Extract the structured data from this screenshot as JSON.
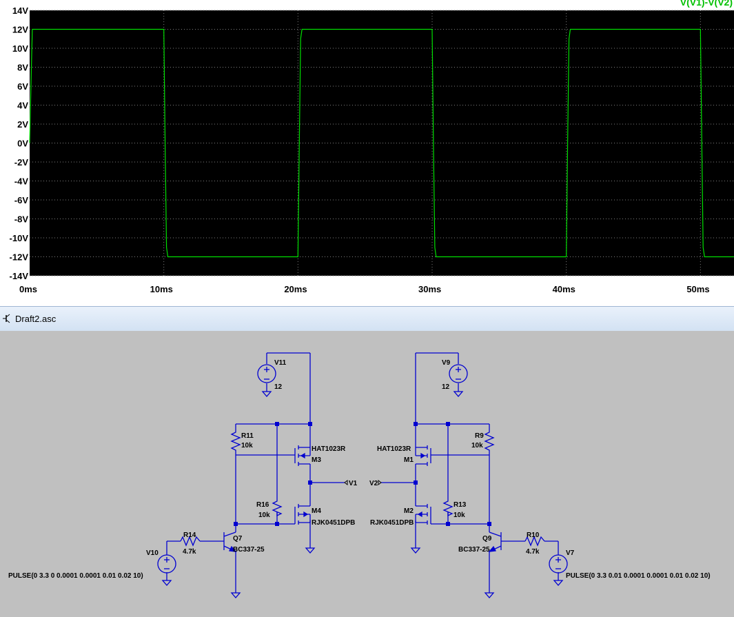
{
  "waveform": {
    "trace_label": "V(V1)-V(V2)",
    "colors": {
      "background": "#000000",
      "trace": "#00e000",
      "grid": "#808080",
      "label": "#00c000"
    },
    "chart_data": {
      "type": "line",
      "title": "",
      "xlabel": "",
      "ylabel": "",
      "xlim": [
        0,
        52.5
      ],
      "ylim": [
        -14,
        14
      ],
      "x_ticks": [
        "0ms",
        "10ms",
        "20ms",
        "30ms",
        "40ms",
        "50ms"
      ],
      "y_ticks": [
        "14V",
        "12V",
        "10V",
        "8V",
        "6V",
        "4V",
        "2V",
        "0V",
        "-2V",
        "-4V",
        "-6V",
        "-8V",
        "-10V",
        "-12V",
        "-14V"
      ],
      "grid": true,
      "series": [
        {
          "name": "V(V1)-V(V2)",
          "x": [
            0,
            0.1,
            0.2,
            10.0,
            10.1,
            10.2,
            10.3,
            20.0,
            20.1,
            20.2,
            20.3,
            30.0,
            30.1,
            30.2,
            30.3,
            40.0,
            40.1,
            40.2,
            40.3,
            50.0,
            50.1,
            50.2,
            50.3,
            52.5
          ],
          "y": [
            0,
            6,
            12,
            12,
            0,
            -11,
            -12,
            -12,
            0,
            11,
            12,
            12,
            0,
            -11,
            -12,
            -12,
            0,
            11,
            12,
            12,
            0,
            -11,
            -12,
            -12
          ]
        }
      ]
    }
  },
  "schematic": {
    "window_title": "Draft2.asc",
    "labels": {
      "v11": "V11",
      "v11_val": "12",
      "v9": "V9",
      "v9_val": "12",
      "r11": "R11",
      "r11_val": "10k",
      "r9": "R9",
      "r9_val": "10k",
      "m3_part": "HAT1023R",
      "m3": "M3",
      "m1_part": "HAT1023R",
      "m1": "M1",
      "net_v1": "V1",
      "net_v2": "V2",
      "r16": "R16",
      "r16_val": "10k",
      "r13": "R13",
      "r13_val": "10k",
      "m4": "M4",
      "m4_part": "RJK0451DPB",
      "m2": "M2",
      "m2_part": "RJK0451DPB",
      "r14": "R14",
      "r14_val": "4.7k",
      "r10": "R10",
      "r10_val": "4.7k",
      "q7": "Q7",
      "q7_part": "BC337-25",
      "q9": "Q9",
      "q9_part": "BC337-25",
      "v10": "V10",
      "v7": "V7",
      "v10_val": "PULSE(0 3.3 0 0.0001 0.0001 0.01 0.02 10)",
      "v7_val": "PULSE(0 3.3 0.01 0.0001 0.0001 0.01 0.02 10)"
    }
  }
}
